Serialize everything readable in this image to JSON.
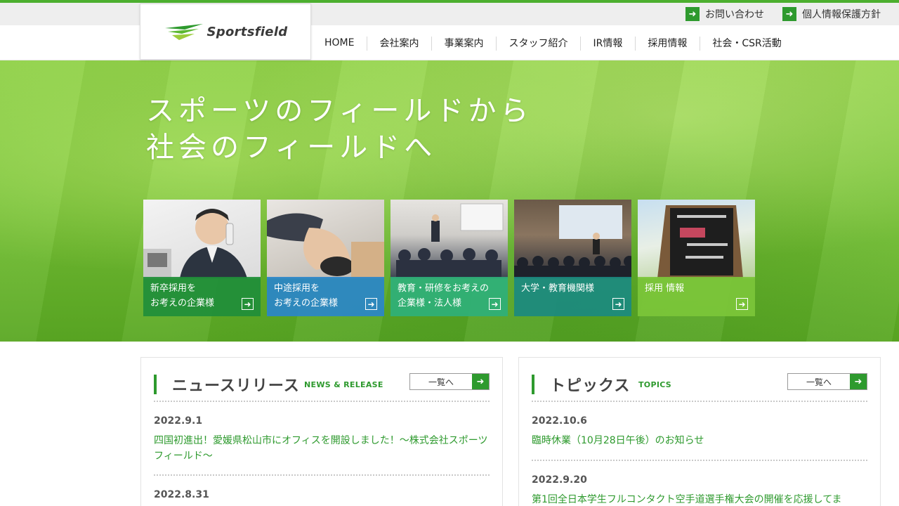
{
  "util_links": [
    {
      "label": "お問い合わせ",
      "icon": "arrow-right-icon"
    },
    {
      "label": "個人情報保護方針",
      "icon": "arrow-right-icon"
    }
  ],
  "logo": {
    "text": "Sportsfield"
  },
  "nav": [
    "HOME",
    "会社案内",
    "事業案内",
    "スタッフ紹介",
    "IR情報",
    "採用情報",
    "社会・CSR活動"
  ],
  "hero": {
    "title_line1": "スポーツのフィールドから",
    "title_line2": "社会のフィールドへ"
  },
  "cards": [
    {
      "line1": "新卒採用を",
      "line2": "お考えの企業様",
      "color": "#1f8e3a"
    },
    {
      "line1": "中途採用を",
      "line2": "お考えの企業様",
      "color": "#2a86c9"
    },
    {
      "line1": "教育・研修をお考えの",
      "line2": "企業様・法人様",
      "color": "#2fb07a"
    },
    {
      "line1": "",
      "line2": "大学・教育機関様",
      "color": "#1b8a80"
    },
    {
      "line1": "",
      "line2": "採用 情報",
      "color": "#7cc63a"
    }
  ],
  "news": {
    "title": "ニュースリリース",
    "subtitle": "NEWS & RELEASE",
    "button_label": "一覧へ",
    "items": [
      {
        "date": "2022.9.1",
        "text": "四国初進出！愛媛県松山市にオフィスを開設しました！～株式会社スポーツフィールド～"
      },
      {
        "date": "2022.8.31",
        "text": ""
      }
    ]
  },
  "topics": {
    "title": "トピックス",
    "subtitle": "TOPICS",
    "button_label": "一覧へ",
    "items": [
      {
        "date": "2022.10.6",
        "text": "臨時休業（10月28日午後）のお知らせ"
      },
      {
        "date": "2022.9.20",
        "text": "第1回全日本学生フルコンタクト空手道選手権大会の開催を応援してま"
      }
    ]
  },
  "colors": {
    "brand_green": "#2e9a2e",
    "accent_bar": "#4caf2f"
  }
}
